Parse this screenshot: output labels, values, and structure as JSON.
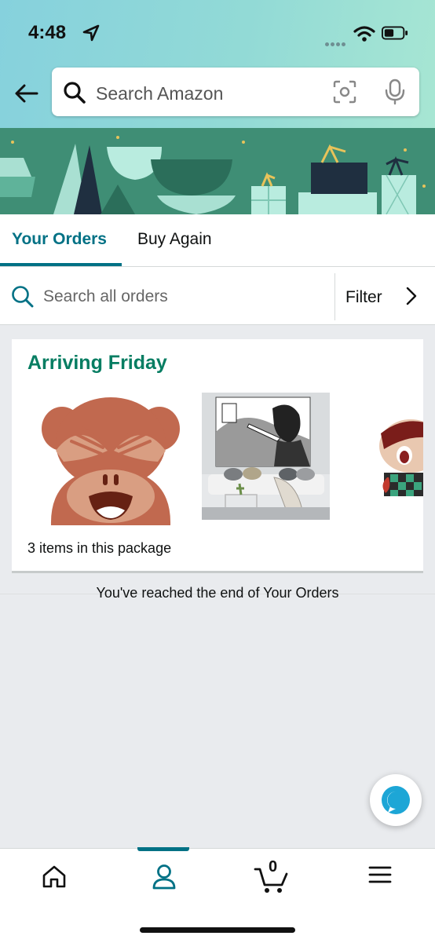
{
  "status_bar": {
    "time": "4:48"
  },
  "header": {
    "search_placeholder": "Search Amazon"
  },
  "tabs": [
    {
      "label": "Your Orders"
    },
    {
      "label": "Buy Again"
    }
  ],
  "order_search": {
    "placeholder": "Search all orders",
    "filter_label": "Filter"
  },
  "order_card": {
    "title": "Arriving Friday",
    "items_count": "3 items in this package",
    "products": [
      {
        "icon": "see-no-evil-monkey-emoji"
      },
      {
        "icon": "anime-tapestry-photo"
      },
      {
        "icon": "anime-plush-doll-photo"
      }
    ]
  },
  "end_message": "You've reached the end of Your Orders",
  "bottom_nav": {
    "cart_count": "0"
  },
  "colors": {
    "accent": "#007185",
    "title_green": "#067d62",
    "banner": "#3f8e75"
  }
}
